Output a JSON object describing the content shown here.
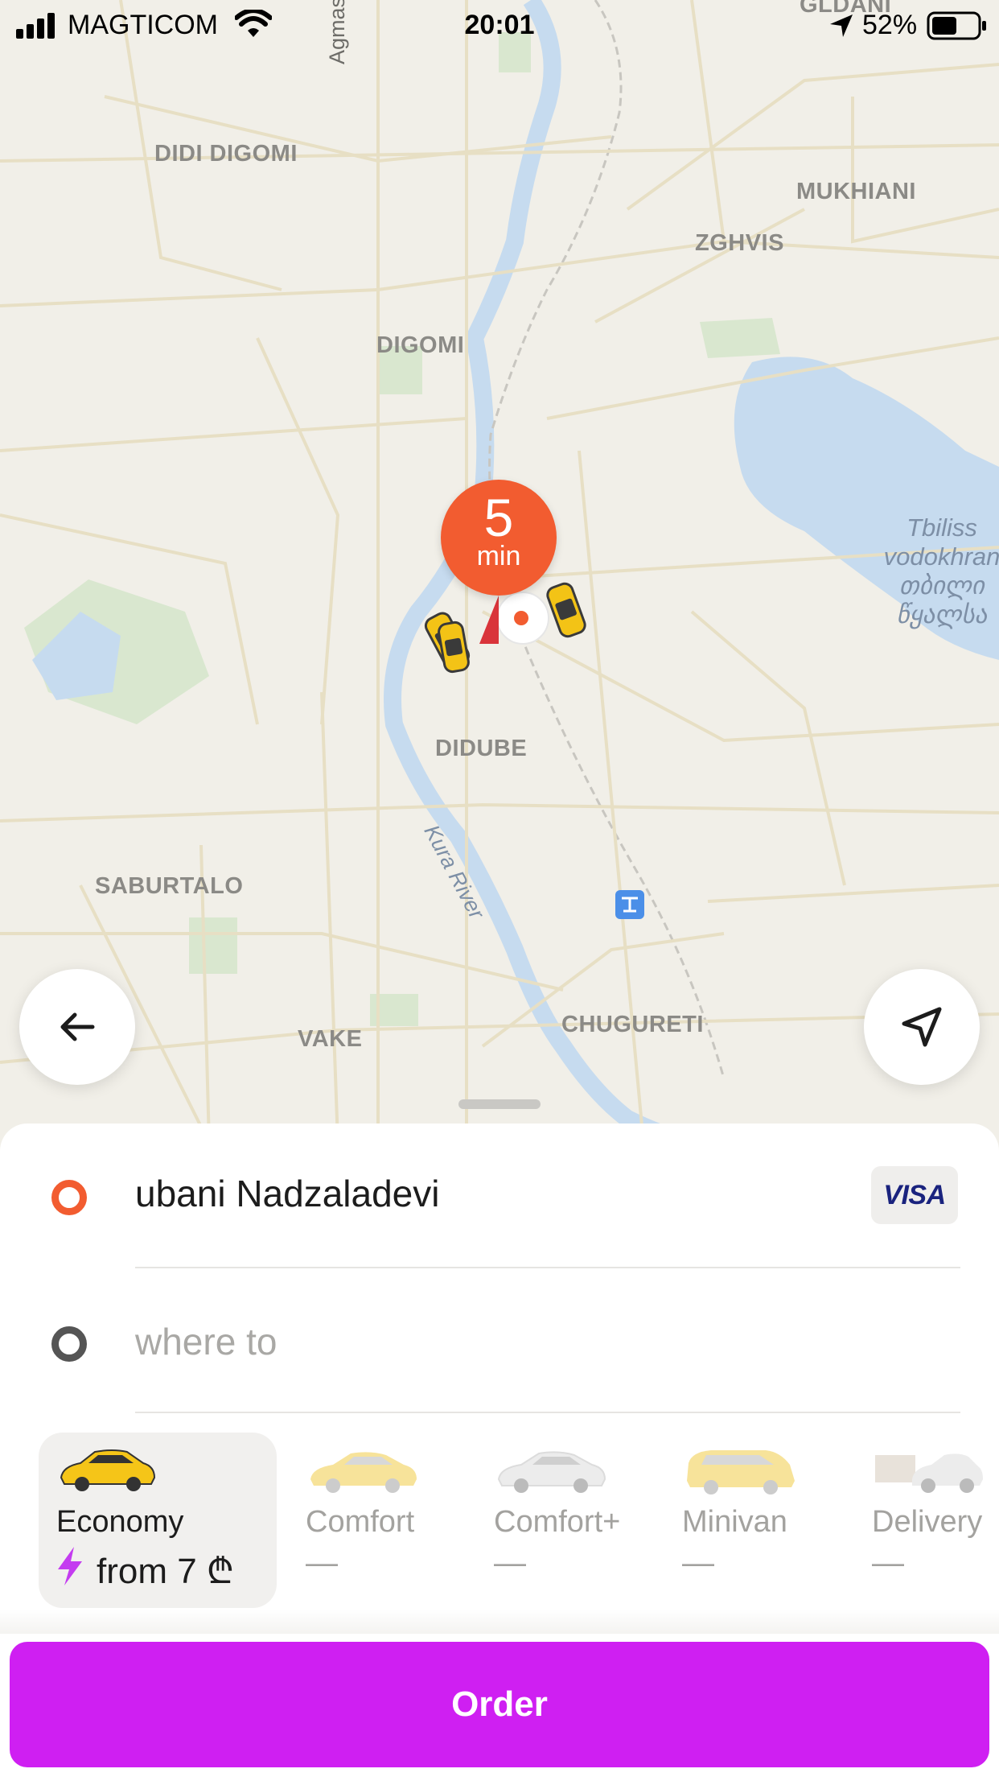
{
  "status_bar": {
    "carrier": "MAGTICOM",
    "time": "20:01",
    "battery": "52%"
  },
  "map": {
    "districts": [
      "DIDI DIGOMI",
      "DIGOMI",
      "MUKHIANI",
      "ZGHVIS",
      "DIDUBE",
      "SABURTALO",
      "VAKE",
      "CHUGURETI",
      "GLDANI"
    ],
    "streets": [
      "Agmasheneb"
    ],
    "river": "Kura River",
    "lake": [
      "Tbiliss",
      "vodokhran",
      "თბილი",
      "წყალსა"
    ]
  },
  "eta": {
    "value": "5",
    "unit": "min"
  },
  "addresses": {
    "pickup": "ubani Nadzaladevi",
    "destination_placeholder": "where to",
    "payment": "VISA"
  },
  "tariffs": [
    {
      "name": "Economy",
      "price": "from 7 ₾",
      "selected": true
    },
    {
      "name": "Comfort",
      "price": "—",
      "selected": false
    },
    {
      "name": "Comfort+",
      "price": "—",
      "selected": false
    },
    {
      "name": "Minivan",
      "price": "—",
      "selected": false
    },
    {
      "name": "Delivery",
      "price": "—",
      "selected": false
    }
  ],
  "order_button": "Order",
  "colors": {
    "accent": "#cf1ff2",
    "pin": "#f25c30",
    "pickup_dot": "#f25c30",
    "destination_dot": "#555555"
  },
  "icons": [
    "signal-icon",
    "wifi-icon",
    "location-arrow-icon",
    "battery-icon",
    "back-arrow-icon",
    "navigate-icon",
    "lightning-icon"
  ]
}
